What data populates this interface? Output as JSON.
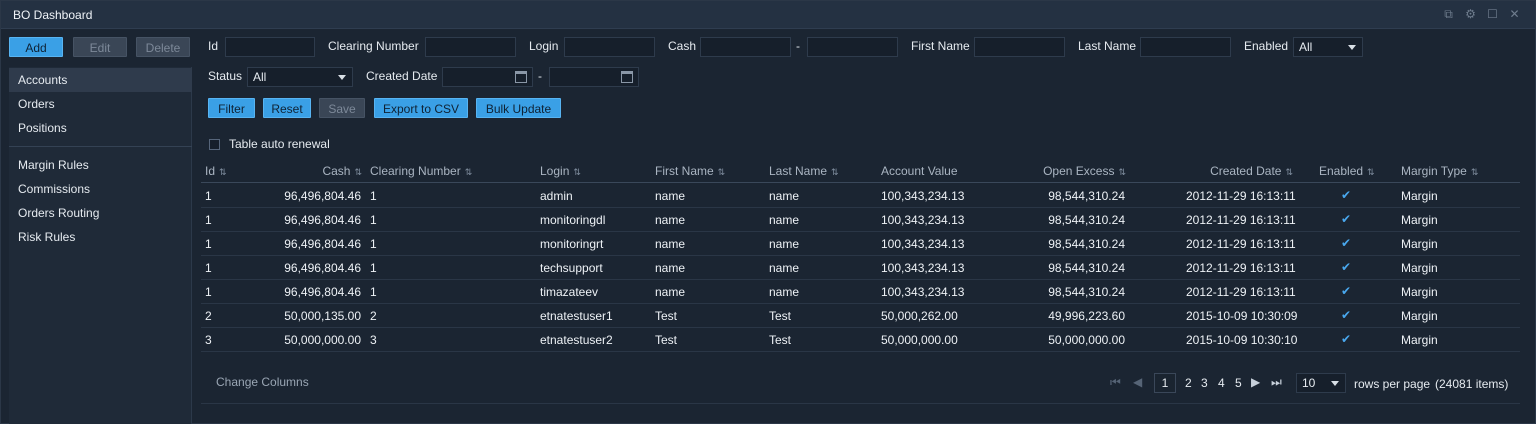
{
  "window": {
    "title": "BO Dashboard",
    "controls": [
      "external-link-icon",
      "gear-icon",
      "maximize-icon",
      "close-icon"
    ]
  },
  "toolbar": {
    "add": "Add",
    "edit": "Edit",
    "delete": "Delete"
  },
  "sidebar": {
    "items": [
      {
        "label": "Accounts",
        "active": true
      },
      {
        "label": "Orders"
      },
      {
        "label": "Positions"
      },
      {
        "label": "Margin Rules"
      },
      {
        "label": "Commissions"
      },
      {
        "label": "Orders Routing"
      },
      {
        "label": "Risk Rules"
      }
    ]
  },
  "filters": {
    "id": {
      "label": "Id",
      "value": ""
    },
    "clearing_number": {
      "label": "Clearing Number",
      "value": ""
    },
    "login": {
      "label": "Login",
      "value": ""
    },
    "cash": {
      "label": "Cash",
      "from": "",
      "to": "",
      "separator": "-"
    },
    "first_name": {
      "label": "First Name",
      "value": ""
    },
    "last_name": {
      "label": "Last Name",
      "value": ""
    },
    "enabled": {
      "label": "Enabled",
      "value": "All"
    },
    "status": {
      "label": "Status",
      "value": "All"
    },
    "created_date": {
      "label": "Created Date",
      "from": "",
      "to": "",
      "separator": "-"
    }
  },
  "actions": {
    "filter": "Filter",
    "reset": "Reset",
    "save": "Save",
    "export": "Export to CSV",
    "bulk_update": "Bulk Update"
  },
  "auto_renewal": {
    "label": "Table auto renewal",
    "checked": false
  },
  "table": {
    "columns": [
      "Id",
      "Cash",
      "Clearing Number",
      "Login",
      "First Name",
      "Last Name",
      "Account Value",
      "Open Excess",
      "Created Date",
      "Enabled",
      "Margin Type"
    ],
    "rows": [
      {
        "id": "1",
        "cash": "96,496,804.46",
        "clearing": "1",
        "login": "admin",
        "first": "name",
        "last": "name",
        "value": "100,343,234.13",
        "excess": "98,544,310.24",
        "created": "2012-11-29 16:13:11",
        "enabled": true,
        "margin": "Margin"
      },
      {
        "id": "1",
        "cash": "96,496,804.46",
        "clearing": "1",
        "login": "monitoringdl",
        "first": "name",
        "last": "name",
        "value": "100,343,234.13",
        "excess": "98,544,310.24",
        "created": "2012-11-29 16:13:11",
        "enabled": true,
        "margin": "Margin"
      },
      {
        "id": "1",
        "cash": "96,496,804.46",
        "clearing": "1",
        "login": "monitoringrt",
        "first": "name",
        "last": "name",
        "value": "100,343,234.13",
        "excess": "98,544,310.24",
        "created": "2012-11-29 16:13:11",
        "enabled": true,
        "margin": "Margin"
      },
      {
        "id": "1",
        "cash": "96,496,804.46",
        "clearing": "1",
        "login": "techsupport",
        "first": "name",
        "last": "name",
        "value": "100,343,234.13",
        "excess": "98,544,310.24",
        "created": "2012-11-29 16:13:11",
        "enabled": true,
        "margin": "Margin"
      },
      {
        "id": "1",
        "cash": "96,496,804.46",
        "clearing": "1",
        "login": "timazateev",
        "first": "name",
        "last": "name",
        "value": "100,343,234.13",
        "excess": "98,544,310.24",
        "created": "2012-11-29 16:13:11",
        "enabled": true,
        "margin": "Margin"
      },
      {
        "id": "2",
        "cash": "50,000,135.00",
        "clearing": "2",
        "login": "etnatestuser1",
        "first": "Test",
        "last": "Test",
        "value": "50,000,262.00",
        "excess": "49,996,223.60",
        "created": "2015-10-09 10:30:09",
        "enabled": true,
        "margin": "Margin"
      },
      {
        "id": "3",
        "cash": "50,000,000.00",
        "clearing": "3",
        "login": "etnatestuser2",
        "first": "Test",
        "last": "Test",
        "value": "50,000,000.00",
        "excess": "50,000,000.00",
        "created": "2015-10-09 10:30:10",
        "enabled": true,
        "margin": "Margin"
      }
    ]
  },
  "footer": {
    "change_columns": "Change Columns",
    "pages": [
      "1",
      "2",
      "3",
      "4",
      "5"
    ],
    "current_page": "1",
    "page_size": "10",
    "rows_per_page": "rows per page",
    "total_items": "(24081 items)"
  },
  "colors": {
    "accent": "#3aa0e6",
    "background": "#1b2532",
    "checkmark": "#49a8ee"
  }
}
